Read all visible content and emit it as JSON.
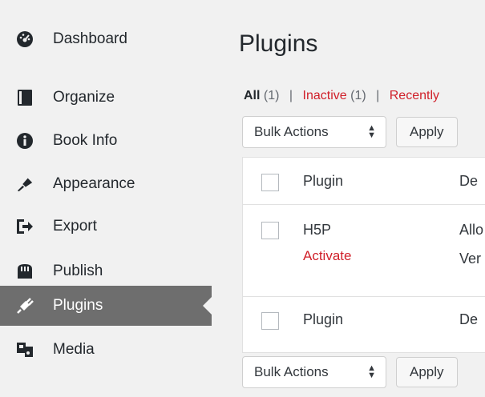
{
  "sidebar": {
    "items": [
      {
        "label": "Dashboard",
        "icon": "dashboard-icon"
      },
      {
        "label": "Organize",
        "icon": "book-icon"
      },
      {
        "label": "Book Info",
        "icon": "info-icon"
      },
      {
        "label": "Appearance",
        "icon": "paintbrush-icon"
      },
      {
        "label": "Export",
        "icon": "export-icon"
      },
      {
        "label": "Publish",
        "icon": "store-icon"
      },
      {
        "label": "Plugins",
        "icon": "plugins-icon",
        "active": true
      },
      {
        "label": "Media",
        "icon": "media-icon"
      }
    ]
  },
  "main": {
    "title": "Plugins",
    "filters": {
      "all_label": "All",
      "all_count": "(1)",
      "inactive_label": "Inactive",
      "inactive_count": "(1)",
      "recent_label": "Recently",
      "separator": "|"
    },
    "bulk_actions_label": "Bulk Actions",
    "apply_label": "Apply",
    "table": {
      "header": {
        "plugin": "Plugin",
        "description": "De"
      },
      "rows": [
        {
          "name": "H5P",
          "action": "Activate",
          "desc_line1": "Allo",
          "desc_line2": "Ver"
        }
      ],
      "footer": {
        "plugin": "Plugin",
        "description": "De"
      }
    }
  },
  "colors": {
    "active_bg": "#6e6e6e",
    "link_red": "#d0202a",
    "background": "#f1f1f1"
  }
}
